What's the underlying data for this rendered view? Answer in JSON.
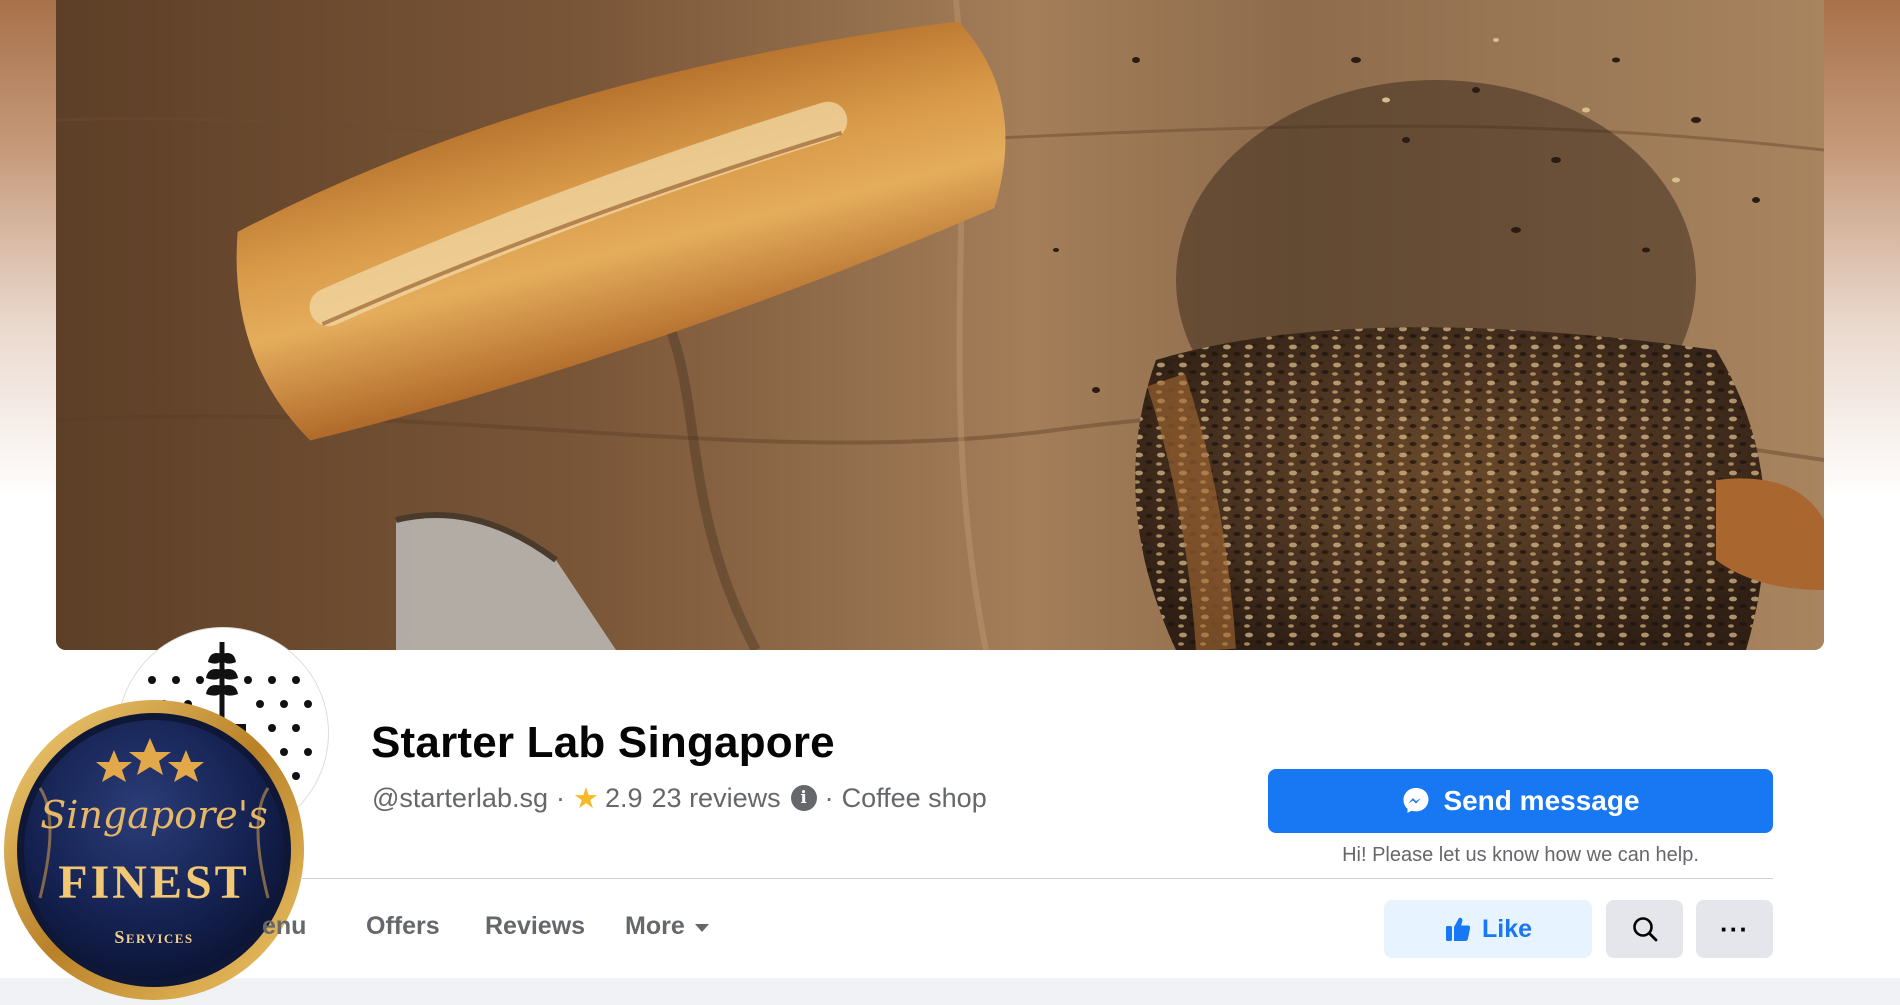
{
  "page": {
    "name": "Starter Lab Singapore",
    "handle": "@starterlab.sg",
    "separator": "·",
    "rating": "2.9",
    "reviews": "23 reviews",
    "category": "Coffee shop",
    "info_icon": "i"
  },
  "actions": {
    "send_message": "Send message",
    "help_text": "Hi! Please let us know how we can help.",
    "like": "Like",
    "more_dots": "···"
  },
  "tabs": {
    "menu": "enu",
    "offers": "Offers",
    "reviews": "Reviews",
    "more": "More"
  },
  "badge": {
    "line1": "Singapore's",
    "line2": "FINEST",
    "line3": "Services"
  },
  "icons": {
    "messenger": "messenger-icon",
    "thumbs_up": "thumbs-up-icon",
    "search": "search-icon",
    "star": "star-icon",
    "info": "info-icon",
    "caret": "caret-down-icon"
  },
  "colors": {
    "primary": "#1877f2",
    "like_bg": "#e7f3ff",
    "secondary_bg": "#e4e6eb",
    "text_primary": "#050505",
    "text_secondary": "#65676b",
    "star": "#f7b928",
    "badge_gold": "#d9a441",
    "badge_navy": "#13204a"
  }
}
